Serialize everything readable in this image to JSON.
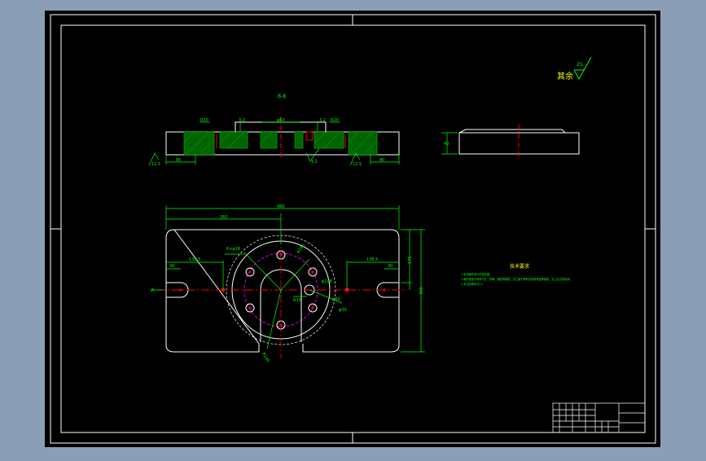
{
  "colors": {
    "background": "#8a9eb6",
    "canvas": "#000000",
    "border": "#ffffff",
    "dimension": "#00ff00",
    "centerline": "#ff0000",
    "hatch": "#00c000",
    "hidden": "#ff00ff"
  },
  "drawing": {
    "roughness_label": "其余",
    "roughness_value": "25",
    "section_label": "B-B",
    "view_label": "A",
    "tech_title": "技术要求",
    "tech_notes": [
      "1.毛坯铸件进行时效处理。",
      "2.铸件表面不得有气孔、砂眼、缩松等缺陷，加工面不得有划伤和锈蚀等缺陷，加工后去除毛刺。",
      "3.未注倒角均为C1。"
    ],
    "top_dims": {
      "d_left": "80",
      "d_right": "80",
      "d_mid": "φ63",
      "d_small": "3.2",
      "d_small2": "3.2",
      "d_r": "R20",
      "d_r2": "R20",
      "rough_left": "12.5",
      "rough_right": "12.5",
      "rough_mid": "3.2"
    },
    "side_dims": {
      "h": "40"
    },
    "plan_dims": {
      "overall": "480",
      "half": "260",
      "height": "300",
      "inner_h": "175",
      "left_slot": "138.5",
      "right_slot": "138.5",
      "slot_w": "30",
      "slot_w2": "30",
      "holes": "6×φ18",
      "circle": "φ180",
      "bolt": "φ108",
      "hole_r": "φ30",
      "hole_r2": "φ30",
      "radius": "R15",
      "bottom_r": "R145",
      "a_mark": "A"
    }
  }
}
